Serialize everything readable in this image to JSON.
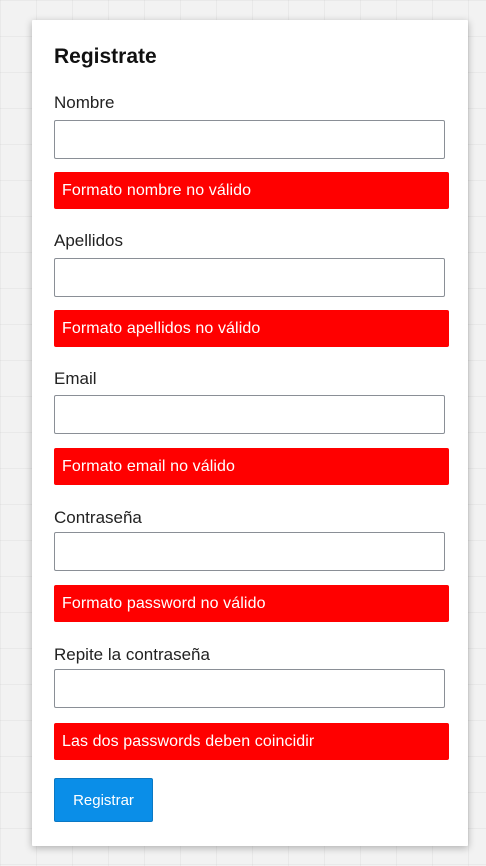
{
  "form": {
    "title": "Registrate",
    "fields": [
      {
        "label": "Nombre",
        "value": "",
        "error": "Formato nombre no válido"
      },
      {
        "label": "Apellidos",
        "value": "",
        "error": "Formato apellidos no válido"
      },
      {
        "label": "Email",
        "value": "",
        "error": "Formato email no válido"
      },
      {
        "label": "Contraseña",
        "value": "",
        "error": "Formato password no válido"
      },
      {
        "label": "Repite la contraseña",
        "value": "",
        "error": "Las dos passwords deben coincidir"
      }
    ],
    "submit_label": "Registrar"
  },
  "colors": {
    "error_background": "#ff0000",
    "button_background": "#0a8ee8",
    "page_background": "#f2f2f2"
  }
}
